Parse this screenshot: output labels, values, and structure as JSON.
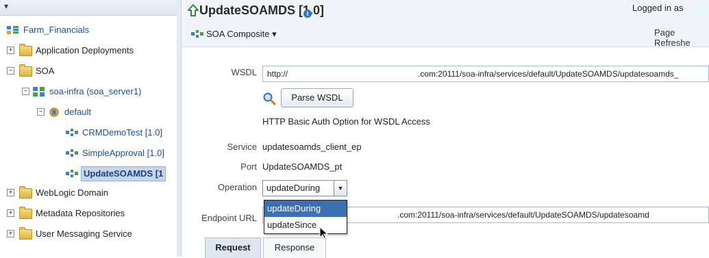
{
  "tree": {
    "top_dropdown": "▾",
    "farm": "Farm_Financials",
    "nodes": {
      "app_deployments": "Application Deployments",
      "soa": "SOA",
      "soa_infra": "soa-infra (soa_server1)",
      "default": "default",
      "crm": "CRMDemoTest [1.0]",
      "simple": "SimpleApproval [1.0]",
      "update": "UpdateSOAMDS [1",
      "weblogic": "WebLogic Domain",
      "metadata": "Metadata Repositories",
      "ums": "User Messaging Service"
    },
    "expanded_symbol": "−",
    "collapsed_symbol": "+"
  },
  "header": {
    "title": "UpdateSOAMDS [1.0]",
    "info": "i",
    "logged_in": "Logged in as",
    "menu": "SOA Composite ▾",
    "refresh": "Page Refreshe"
  },
  "form": {
    "wsdl_label": "WSDL",
    "wsdl_prefix": "http://",
    "wsdl_suffix": ".com:20111/soa-infra/services/default/UpdateSOAMDS/updatesoamds_",
    "parse_button": "Parse WSDL",
    "auth_link": "HTTP Basic Auth Option for WSDL Access",
    "service_label": "Service",
    "service_value": "updatesoamds_client_ep",
    "port_label": "Port",
    "port_value": "UpdateSOAMDS_pt",
    "operation_label": "Operation",
    "operation_value": "updateDuring",
    "operation_options": [
      "updateDuring",
      "updateSince"
    ],
    "endpoint_label": "Endpoint URL",
    "endpoint_suffix": ".com:20111/soa-infra/services/default/UpdateSOAMDS/updatesoamd"
  },
  "tabs": {
    "request": "Request",
    "response": "Response"
  },
  "colors": {
    "accent": "#1a4e99",
    "highlight": "#3d6fb3"
  }
}
